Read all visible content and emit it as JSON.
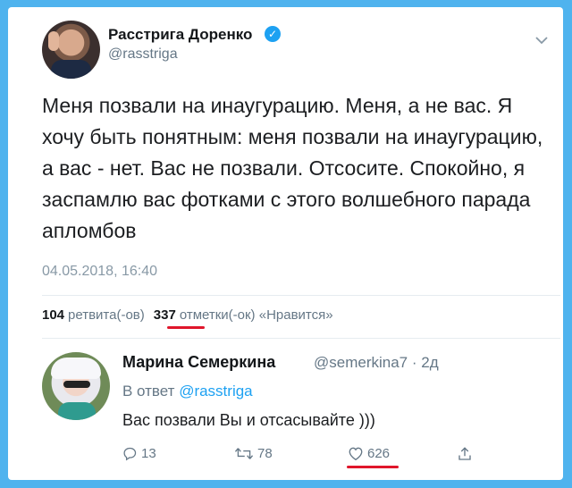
{
  "tweet": {
    "author_name": "Расстрига Доренко",
    "author_handle": "@rasstriga",
    "text": "Меня позвали на инаугурацию. Меня, а не вас. Я хочу быть понятным: меня позвали на инаугурацию, а вас - нет. Вас не позвали. Отсосите. Спокойно, я заспамлю вас фотками с этого волшебного парада апломбов",
    "datetime": "04.05.2018, 16:40",
    "retweets_count": "104",
    "retweets_label": "ретвита(-ов)",
    "likes_count": "337",
    "likes_label": "отметки(-ок) «Нравится»"
  },
  "reply": {
    "author_name": "Марина Семеркина",
    "author_handle": "@semerkina7",
    "age": "· 2д",
    "in_reply_prefix": "В ответ",
    "in_reply_handle": "@rasstriga",
    "text": "Вас позвали Вы и отсасывайте )))",
    "replies_count": "13",
    "retweets_count": "78",
    "likes_count": "626"
  },
  "colors": {
    "background": "#4fb3ee",
    "accent": "#1da1f2",
    "underline": "#e0162b",
    "muted": "#657786"
  },
  "icons": [
    "verified-badge-icon",
    "chevron-down-icon",
    "reply-icon",
    "retweet-icon",
    "heart-icon",
    "share-icon"
  ]
}
